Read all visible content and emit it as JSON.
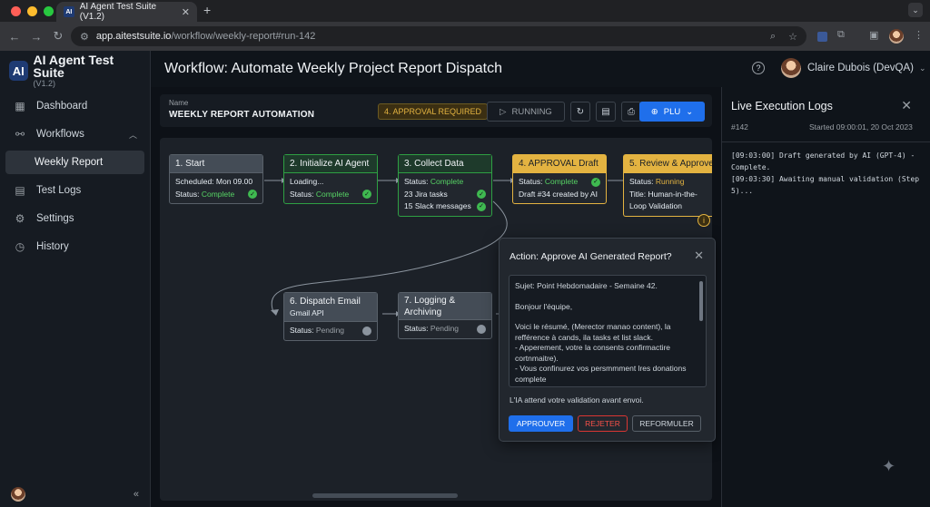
{
  "browser": {
    "tab_title": "AI Agent Test Suite (V1.2)",
    "tab_favicon": "AI",
    "url_host": "app.aitestsuite.io",
    "url_path": "/workflow/weekly-report#run-142"
  },
  "sidebar": {
    "brand_logo": "AI",
    "brand_title": "AI Agent Test Suite",
    "brand_version": "(V1.2)",
    "items": [
      {
        "label": "Dashboard"
      },
      {
        "label": "Workflows"
      },
      {
        "label": "Weekly Report"
      },
      {
        "label": "Test Logs"
      },
      {
        "label": "Settings"
      },
      {
        "label": "History"
      }
    ]
  },
  "header": {
    "title": "Workflow: Automate Weekly Project Report Dispatch",
    "user_name": "Claire Dubois (DevQA)"
  },
  "workflow": {
    "name_label": "Name",
    "name": "WEEKLY REPORT AUTOMATION",
    "badge": "4. APPROVAL REQUIRED",
    "run_label": "RUNNING",
    "plu_label": "PLU"
  },
  "nodes": [
    {
      "title": "1. Start",
      "line1": "Scheduled: Mon 09.00",
      "status_label": "Status:",
      "status": "Complete"
    },
    {
      "title": "2. Initialize AI Agent",
      "line1": "Loading...",
      "status_label": "Status:",
      "status": "Complete"
    },
    {
      "title": "3. Collect Data",
      "status_label": "Status:",
      "status": "Complete",
      "line2": "23 Jira tasks",
      "line3": "15 Slack messages"
    },
    {
      "title": "4. APPROVAL Draft",
      "status_label": "Status:",
      "status": "Complete",
      "line2": "Draft #34 created by AI"
    },
    {
      "title": "5. Review & Approve",
      "status_label": "Status:",
      "status": "Running",
      "line2": "Title: Human-in-the-Loop Validation"
    },
    {
      "title": "6. Dispatch Email",
      "line1": "Gmail API",
      "status_label": "Status:",
      "status": "Pending"
    },
    {
      "title": "7. Logging & Archiving",
      "status_label": "Status:",
      "status": "Pending"
    }
  ],
  "modal": {
    "title": "Action: Approve AI Generated Report?",
    "body": [
      "Sujet: Point Hebdomadaire - Semaine 42.",
      "Bonjour l'équipe,",
      "Voici le résumé, (Merector manao content), la refférence à cands, ila tasks et list slack.",
      "- Apperement, votre la consents confirmactire cortnmaitre).",
      "- Vous confinurez vos persmmment lres donations complete"
    ],
    "note": "L'IA attend votre validation avant envoi.",
    "approve": "APPROUVER",
    "reject": "REJETER",
    "reformulate": "REFORMULER"
  },
  "logs": {
    "title": "Live Execution Logs",
    "run": "#142",
    "started": "Started 09:00:01, 20 Oct 2023",
    "lines": [
      "[09:03:00] Draft generated by AI (GPT-4) - Complete.",
      "[09:03:30] Awaiting manual validation (Step 5)..."
    ]
  },
  "colors": {
    "accent": "#1f6feb",
    "complete": "#3fb950",
    "running": "#e3b341",
    "reject": "#f85149"
  }
}
